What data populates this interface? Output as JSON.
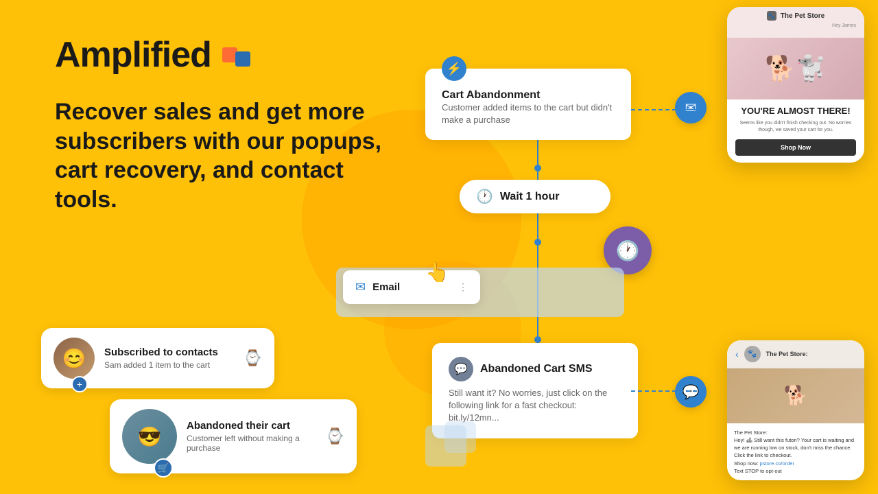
{
  "app": {
    "name": "Amplified",
    "logo_icon": "logo-icon"
  },
  "tagline": "Recover sales and get more subscribers with our popups, cart recovery, and contact tools.",
  "flow": {
    "cart_abandonment": {
      "title": "Cart Abandonment",
      "description": "Customer added items to the cart but didn't make a purchase"
    },
    "wait": {
      "text": "Wait",
      "bold_text": "1 hour"
    },
    "email": {
      "label": "Email"
    },
    "sms": {
      "title": "Abandoned Cart SMS",
      "description": "Still want it? No worries, just click on the following link for a fast checkout: bit.ly/12mn..."
    }
  },
  "contacts": {
    "subscribed": {
      "title": "Subscribed to contacts",
      "subtitle": "Sam added 1 item to the cart"
    },
    "abandoned": {
      "title": "Abandoned their cart",
      "subtitle": "Customer left without making a purchase"
    }
  },
  "email_preview": {
    "store_name": "The Pet Store",
    "greeting": "Hey James",
    "headline": "YOU'RE ALMOST THERE!",
    "body": "Seems like you didn't finish checking out. No worries though, we saved your cart for you.",
    "cta": "Shop Now"
  },
  "sms_preview": {
    "store_name": "The Pet Store:",
    "message": "Hey! 🛋 Still want this futon? Your cart is waiting and we are running low on stock, don't miss the chance. Click the link to checkout.",
    "shop_link": "pstore.co/order",
    "shop_link_2": "Shop now:",
    "opt_out": "Text STOP to opt-out"
  },
  "icons": {
    "lightning": "⚡",
    "clock": "🕐",
    "email": "✉",
    "sms": "💬",
    "watch": "⌚",
    "cart": "🛒",
    "plus": "+",
    "back": "‹",
    "paw": "🐾"
  }
}
